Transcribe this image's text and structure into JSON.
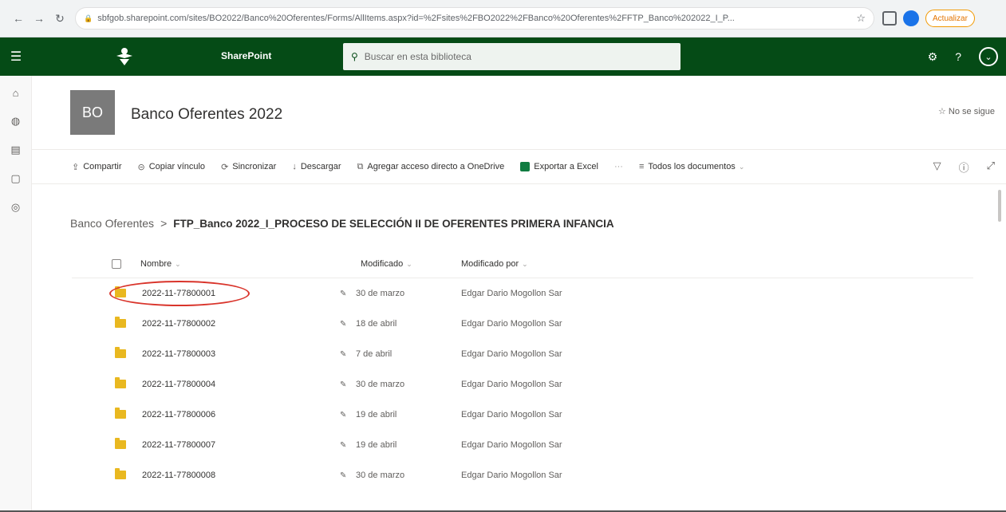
{
  "browser": {
    "url": "sbfgob.sharepoint.com/sites/BO2022/Banco%20Oferentes/Forms/AllItems.aspx?id=%2Fsites%2FBO2022%2FBanco%20Oferentes%2FFTP_Banco%202022_I_P...",
    "update_label": "Actualizar"
  },
  "suite": {
    "title": "SharePoint",
    "search_placeholder": "Buscar en esta biblioteca",
    "help": "?"
  },
  "site": {
    "logo_initials": "BO",
    "title": "Banco Oferentes 2022",
    "follow_label": "No se sigue"
  },
  "commands": {
    "share": "Compartir",
    "copy_link": "Copiar vínculo",
    "sync": "Sincronizar",
    "download": "Descargar",
    "add_shortcut": "Agregar acceso directo a OneDrive",
    "export_excel": "Exportar a Excel",
    "more": "···",
    "view": "Todos los documentos"
  },
  "breadcrumb": {
    "root": "Banco Oferentes",
    "separator": ">",
    "current": "FTP_Banco 2022_I_PROCESO DE SELECCIÓN II DE OFERENTES PRIMERA INFANCIA"
  },
  "list": {
    "headers": {
      "name": "Nombre",
      "modified": "Modificado",
      "modified_by": "Modificado por"
    },
    "rows": [
      {
        "name": "2022-11-77800001",
        "modified": "30 de marzo",
        "modified_by": "Edgar Dario Mogollon Sar"
      },
      {
        "name": "2022-11-77800002",
        "modified": "18 de abril",
        "modified_by": "Edgar Dario Mogollon Sar"
      },
      {
        "name": "2022-11-77800003",
        "modified": "7 de abril",
        "modified_by": "Edgar Dario Mogollon Sar"
      },
      {
        "name": "2022-11-77800004",
        "modified": "30 de marzo",
        "modified_by": "Edgar Dario Mogollon Sar"
      },
      {
        "name": "2022-11-77800006",
        "modified": "19 de abril",
        "modified_by": "Edgar Dario Mogollon Sar"
      },
      {
        "name": "2022-11-77800007",
        "modified": "19 de abril",
        "modified_by": "Edgar Dario Mogollon Sar"
      },
      {
        "name": "2022-11-77800008",
        "modified": "30 de marzo",
        "modified_by": "Edgar Dario Mogollon Sar"
      }
    ]
  },
  "colors": {
    "suite_bar": "#054b16",
    "highlight": "#d9342b",
    "folder": "#e9b820"
  }
}
